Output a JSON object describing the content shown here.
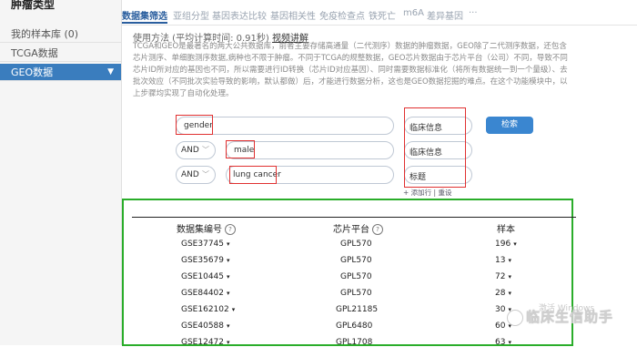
{
  "sidebar": {
    "title": "肿瘤类型",
    "items": [
      {
        "label": "我的样本库 (0)",
        "active": false
      },
      {
        "label": "TCGA数据",
        "active": false
      },
      {
        "label": "GEO数据",
        "active": true,
        "arrow": "▼"
      }
    ]
  },
  "tabs": [
    {
      "label": "数据集筛选",
      "active": true
    },
    {
      "label": "亚组分型",
      "active": false
    },
    {
      "label": "基因表达比较",
      "active": false
    },
    {
      "label": "基因相关性",
      "active": false
    },
    {
      "label": "免疫检查点",
      "active": false
    },
    {
      "label": "铁死亡",
      "active": false
    },
    {
      "label": "m6A",
      "active": false
    },
    {
      "label": "差异基因",
      "active": false
    },
    {
      "label": "···",
      "active": false
    }
  ],
  "usage": {
    "prefix": "使用方法 (平均计算时间: 0.91秒)",
    "link": "视频讲解"
  },
  "description": "TCGA和GEO是最著名的两大公共数据库，前者主要存储高通量（二代测序）数据的肿瘤数据，GEO除了二代测序数据，还包含芯片测序、单细胞测序数据,病种也不限于肿瘤。不同于TCGA的规整数据，GEO芯片数据由于芯片平台（公司）不同，导致不同芯片ID所对应的基因也不同，所以需要进行ID转换（芯片ID对应基因）、同时需要数据标准化（将所有数据统一到一个量级）、去批次效应（不同批次实验导致的影响，默认都做）后，才能进行数据分析，这也是GEO数据挖掘的难点。在这个功能模块中，以上步骤均实现了自动化处理。",
  "query": {
    "row1": {
      "term": "gender",
      "field": "临床信息"
    },
    "row2": {
      "op": "AND",
      "term": "male",
      "field": "临床信息"
    },
    "row3": {
      "op": "AND",
      "term": "lung cancer",
      "field": "标题"
    },
    "search_label": "检索",
    "add_label": "+ 添加行 | 重设"
  },
  "table": {
    "headers": {
      "dataset": "数据集编号",
      "platform": "芯片平台",
      "samples": "样本"
    },
    "help_icon": "?",
    "caret": "▾",
    "rows": [
      {
        "id": "GSE37745",
        "platform": "GPL570",
        "samples": "196"
      },
      {
        "id": "GSE35679",
        "platform": "GPL570",
        "samples": "13"
      },
      {
        "id": "GSE10445",
        "platform": "GPL570",
        "samples": "72"
      },
      {
        "id": "GSE84402",
        "platform": "GPL570",
        "samples": "28"
      },
      {
        "id": "GSE162102",
        "platform": "GPL21185",
        "samples": "30"
      },
      {
        "id": "GSE40588",
        "platform": "GPL6480",
        "samples": "60"
      },
      {
        "id": "GSE12472",
        "platform": "GPL1708",
        "samples": "63"
      }
    ]
  },
  "watermark": {
    "windows": "激活 Windows",
    "brand": "临床生信助手"
  },
  "colors": {
    "accent": "#3a7dbe",
    "highlight_red": "#e03030",
    "highlight_green": "#2aad2a"
  }
}
